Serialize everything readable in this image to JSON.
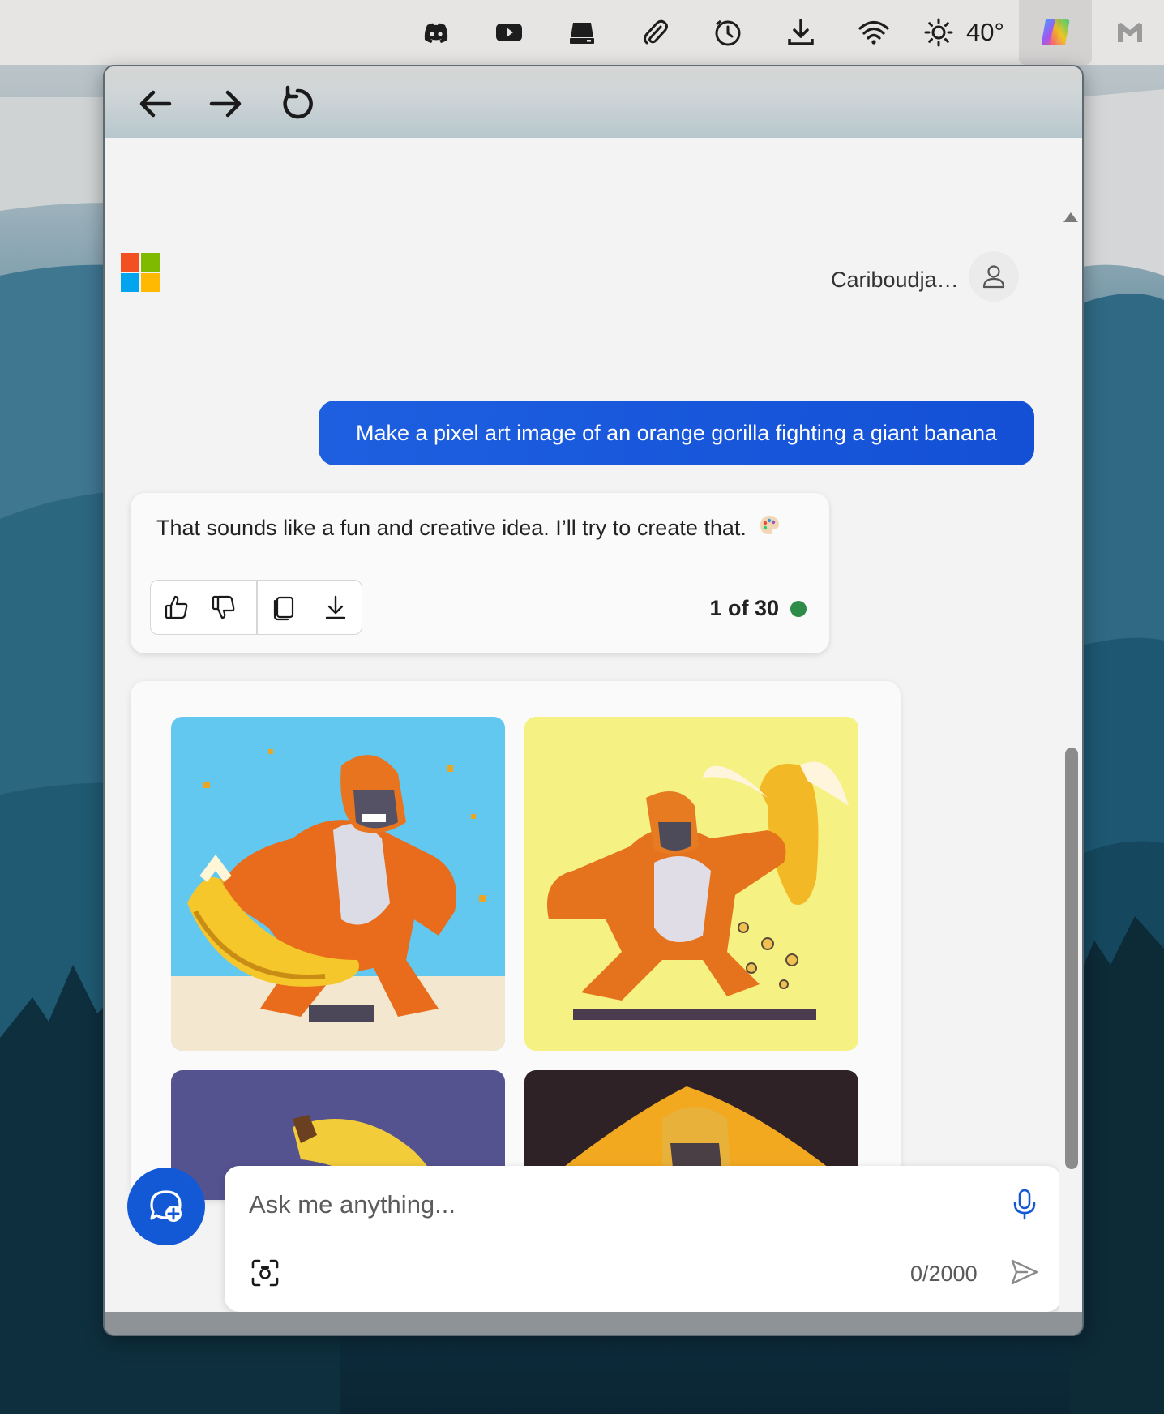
{
  "system_bar": {
    "icons": [
      "discord-icon",
      "youtube-icon",
      "drive-icon",
      "paperclip-icon",
      "timer-icon",
      "download-icon",
      "wifi-icon",
      "brightness-icon",
      "copilot-icon",
      "gmail-icon"
    ],
    "temperature": "40°"
  },
  "browser": {
    "nav": [
      "back-arrow-icon",
      "forward-arrow-icon",
      "reload-icon"
    ]
  },
  "header": {
    "username": "Cariboudja…"
  },
  "chat": {
    "user_message": "Make a pixel art image of an orange gorilla fighting a giant banana",
    "bot_message": "That sounds like a fun and creative idea. I’ll try to create that.",
    "bot_emoji": "🎨",
    "actions": [
      "thumbs-up-icon",
      "thumbs-down-icon",
      "copy-icon",
      "download-icon"
    ],
    "counter": "1 of 30",
    "counter_status_color": "#2e8b48",
    "images_count": 4
  },
  "composer": {
    "placeholder": "Ask me anything...",
    "char_count": "0/2000"
  },
  "colors": {
    "accent": "#1359d6",
    "user_bubble": "#1e5fe0"
  }
}
